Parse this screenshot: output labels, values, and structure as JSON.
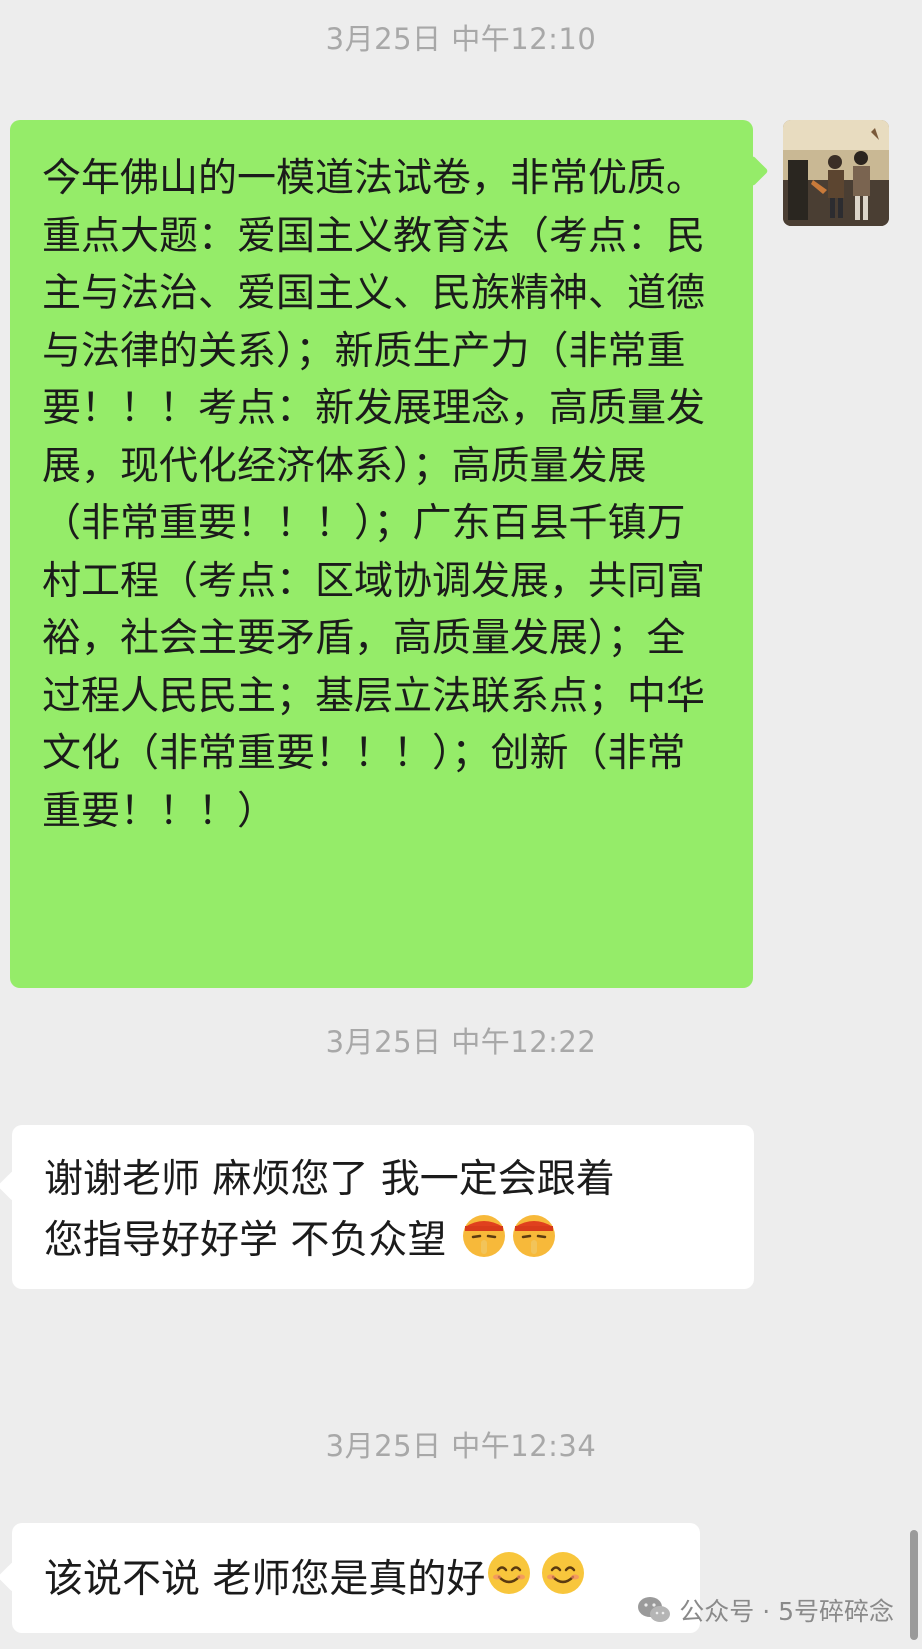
{
  "chat": {
    "timestamps": [
      "3月25日 中午12:10",
      "3月25日 中午12:22",
      "3月25日 中午12:34"
    ],
    "messages": [
      {
        "from": "me",
        "text": "今年佛山的一模道法试卷，非常优质。重点大题：爱国主义教育法（考点：民主与法治、爱国主义、民族精神、道德与法律的关系）；新质生产力（非常重要！！！考点：新发展理念，高质量发展，现代化经济体系）；高质量发展（非常重要！！！）；广东百县千镇万村工程（考点：区域协调发展，共同富裕，社会主要矛盾，高质量发展）；全过程人民民主；基层立法联系点；中华文化（非常重要！！！）；创新（非常重要！！！）"
      },
      {
        "from": "other",
        "text_line1": "谢谢老师 麻烦您了 我一定会跟着",
        "text_line2": "您指导好好学 不负众望 ",
        "emojis": [
          "shush-face-emoji",
          "shush-face-emoji"
        ]
      },
      {
        "from": "other",
        "text": "该说不说 老师您是真的好",
        "emojis": [
          "smiling-face-emoji",
          "smiling-face-emoji"
        ]
      }
    ]
  },
  "watermark": {
    "text": "公众号 · 5号碎碎念",
    "icon": "wechat-icon"
  },
  "colors": {
    "background": "#ededed",
    "outgoing_bubble": "#95ec69",
    "incoming_bubble": "#ffffff",
    "timestamp": "#a8a8a8"
  }
}
